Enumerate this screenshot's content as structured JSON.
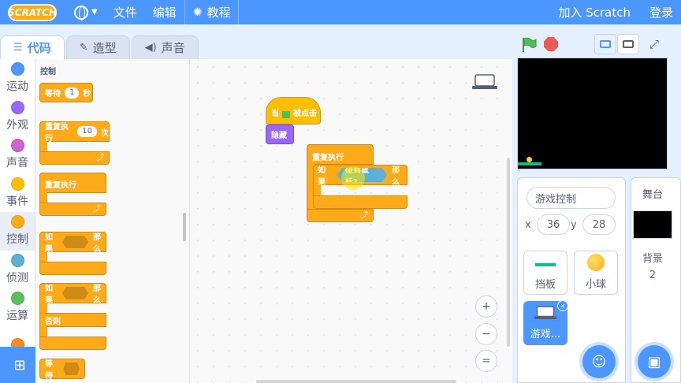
{
  "menubar": {
    "logo": "SCRATCH",
    "file": "文件",
    "edit": "编辑",
    "tutorials": "教程",
    "join": "加入 Scratch",
    "signin": "登录"
  },
  "tabs": [
    {
      "label": "代码"
    },
    {
      "label": "造型"
    },
    {
      "label": "声音"
    }
  ],
  "categories": [
    {
      "label": "运动",
      "color": "#4c97ff"
    },
    {
      "label": "外观",
      "color": "#9966ff"
    },
    {
      "label": "声音",
      "color": "#cf63cf"
    },
    {
      "label": "事件",
      "color": "#ffbf00"
    },
    {
      "label": "控制",
      "color": "#ffab19"
    },
    {
      "label": "侦测",
      "color": "#5cb1d6"
    },
    {
      "label": "运算",
      "color": "#59c059"
    },
    {
      "label": "",
      "color": "#ff8c1a"
    }
  ],
  "palette": {
    "title": "控制",
    "wait": {
      "label": "等待",
      "value": "1",
      "unit": "秒"
    },
    "repeat": {
      "label": "重复执行",
      "value": "10",
      "unit": "次"
    },
    "forever": "重复执行",
    "if_then": {
      "if": "如果",
      "then": "那么"
    },
    "if_else": {
      "if": "如果",
      "then": "那么",
      "else": "否则"
    },
    "wait_until": "等待"
  },
  "workspace": {
    "when_flag": {
      "prefix": "当",
      "suffix": "被点击"
    },
    "hide": "隐藏",
    "forever": "重复执行",
    "if": "如果",
    "condition": "碰到鼠标?",
    "then": "那么"
  },
  "zoom": {
    "in": "+",
    "out": "−",
    "reset": "="
  },
  "sprite": {
    "name": "游戏控制",
    "x_label": "x",
    "x": "36",
    "y_label": "y",
    "y": "28"
  },
  "sprites": [
    {
      "name": "挡板"
    },
    {
      "name": "小球"
    },
    {
      "name": "游戏..."
    }
  ],
  "stage_pane": {
    "title": "舞台",
    "backdrop_label": "背景",
    "backdrop_count": "2"
  }
}
